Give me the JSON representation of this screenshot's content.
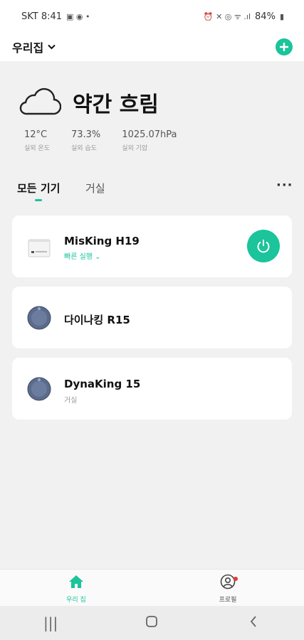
{
  "status_bar": {
    "carrier_time": "SKT 8:41",
    "battery": "84%"
  },
  "header": {
    "home_name": "우리집"
  },
  "weather": {
    "condition": "약간 흐림",
    "stats": [
      {
        "value": "12°C",
        "label": "실외 온도"
      },
      {
        "value": "73.3%",
        "label": "실외 습도"
      },
      {
        "value": "1025.07hPa",
        "label": "실외 기압"
      }
    ]
  },
  "tabs": [
    {
      "label": "모든 기기",
      "active": true
    },
    {
      "label": "거실",
      "active": false
    }
  ],
  "devices": [
    {
      "name": "MisKing H19",
      "sub": "빠른 실행",
      "icon": "humidifier-icon",
      "has_power": true
    },
    {
      "name": "다이나킹 R15",
      "sub": "",
      "icon": "robot-vacuum-icon",
      "has_power": false
    },
    {
      "name": "DynaKing 15",
      "sub": "거실",
      "icon": "robot-vacuum-icon",
      "has_power": false
    }
  ],
  "bottom_nav": {
    "home_label": "우리 집",
    "profile_label": "프로필"
  },
  "colors": {
    "accent": "#1bc49a",
    "background": "#f1f1f1",
    "notification": "#e53935"
  }
}
